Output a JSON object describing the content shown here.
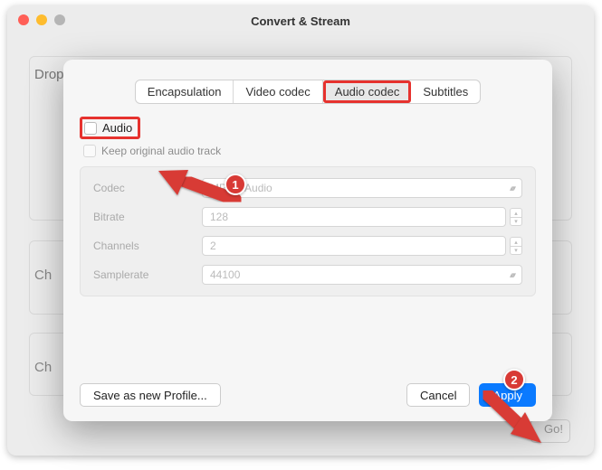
{
  "window": {
    "title": "Convert & Stream",
    "bg_text_drop": "Drop media here",
    "bg_label_ch1": "Ch",
    "bg_label_ch2": "Ch",
    "go_label": "Go!"
  },
  "tabs": {
    "encapsulation": "Encapsulation",
    "video": "Video codec",
    "audio": "Audio codec",
    "subtitles": "Subtitles"
  },
  "audio": {
    "checkbox_label": "Audio",
    "keep_label": "Keep original audio track",
    "codec_label": "Codec",
    "codec_value": "MPEG Audio",
    "bitrate_label": "Bitrate",
    "bitrate_value": "128",
    "channels_label": "Channels",
    "channels_value": "2",
    "samplerate_label": "Samplerate",
    "samplerate_value": "44100"
  },
  "footer": {
    "save_profile": "Save as new Profile...",
    "cancel": "Cancel",
    "apply": "Apply"
  },
  "annotations": {
    "step1": "1",
    "step2": "2"
  }
}
